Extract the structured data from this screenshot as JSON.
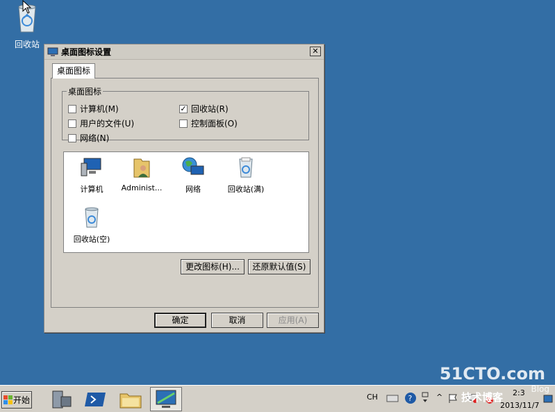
{
  "desktop": {
    "recycle_label": "回收站"
  },
  "dialog": {
    "title": "桌面图标设置",
    "tab": "桌面图标",
    "group_title": "桌面图标",
    "checkboxes": [
      {
        "label": "计算机(M)",
        "checked": false
      },
      {
        "label": "回收站(R)",
        "checked": true
      },
      {
        "label": "用户的文件(U)",
        "checked": false
      },
      {
        "label": "控制面板(O)",
        "checked": false
      },
      {
        "label": "网络(N)",
        "checked": false
      }
    ],
    "icons": [
      {
        "label": "计算机",
        "icon": "computer-icon"
      },
      {
        "label": "Administ...",
        "icon": "user-folder-icon"
      },
      {
        "label": "网络",
        "icon": "network-icon"
      },
      {
        "label": "回收站(满)",
        "icon": "recycle-bin-full-icon"
      },
      {
        "label": "回收站(空)",
        "icon": "recycle-bin-empty-icon"
      }
    ],
    "change_icon": "更改图标(H)...",
    "restore_default": "还原默认值(S)",
    "ok": "确定",
    "cancel": "取消",
    "apply": "应用(A)"
  },
  "taskbar": {
    "start": "开始",
    "lang": "CH",
    "clock_time": "2:3",
    "clock_date": "2013/11/7"
  },
  "watermark": {
    "brand": "51CTO.com",
    "text": "技术博客",
    "suffix": "Blog"
  }
}
